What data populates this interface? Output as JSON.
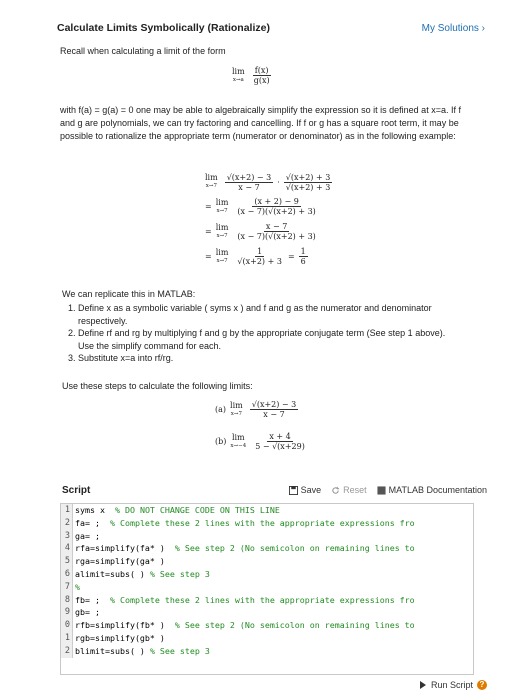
{
  "header": {
    "title": "Calculate Limits Symbolically (Rationalize)",
    "my_solutions": "My Solutions ›"
  },
  "intro": {
    "line1": "Recall when calculating a limit of the form"
  },
  "limit_form": {
    "lim": "lim",
    "sub": "x→a",
    "num": "f(x)",
    "den": "g(x)"
  },
  "para1": "with f(a) = g(a) = 0 one may be able to algebraically simplify the expression so it is defined at x=a. If f and g are polynomials, we can try factoring and cancelling. If f or g has a square root term, it may be possible to rationalize the appropriate term (numerator or denominator) as in the following example:",
  "example": {
    "row1": {
      "lim": "lim",
      "sub": "x→7",
      "num1": "√(x+2) − 3",
      "den1": "x − 7",
      "dot": "·",
      "num2": "√(x+2) + 3",
      "den2": "√(x+2) + 3"
    },
    "row2": {
      "eq": "=",
      "lim": "lim",
      "sub": "x→7",
      "num": "(x + 2) − 9",
      "den": "(x − 7)(√(x+2) + 3)"
    },
    "row3": {
      "eq": "=",
      "lim": "lim",
      "sub": "x→7",
      "num": "x − 7",
      "den": "(x − 7)(√(x+2) + 3)"
    },
    "row4": {
      "eq": "=",
      "lim": "lim",
      "sub": "x→7",
      "num": "1",
      "den": "√(x+2) + 3",
      "eq2": "=",
      "num2": "1",
      "den2": "6"
    }
  },
  "replicate": {
    "intro": "We can replicate this in MATLAB:",
    "steps": [
      "Define x as a symbolic variable ( syms x ) and f and g as the numerator and denominator respectively.",
      "Define rf and rg by multiplying f and g by the appropriate conjugate term (See step 1 above). Use the simplify command for each.",
      "Substitute x=a into rf/rg."
    ],
    "use_steps": "Use these steps to calculate the following limits:"
  },
  "limits": {
    "a": {
      "label": "(a)",
      "lim": "lim",
      "sub": "x→7",
      "num": "√(x+2) − 3",
      "den": "x − 7"
    },
    "b": {
      "label": "(b)",
      "lim": "lim",
      "sub": "x→−4",
      "num": "x + 4",
      "den": "5 − √(x+29)"
    }
  },
  "script": {
    "label": "Script",
    "save": "Save",
    "reset": "Reset",
    "doc": "MATLAB Documentation",
    "lines": [
      {
        "n": "1",
        "code": "syms x  ",
        "comment": "% DO NOT CHANGE CODE ON THIS LINE"
      },
      {
        "n": "2",
        "code": "fa= ;  ",
        "comment": "% Complete these 2 lines with the appropriate expressions fro"
      },
      {
        "n": "3",
        "code": "ga= ;",
        "comment": ""
      },
      {
        "n": "4",
        "code": "rfa=simplify(fa* )  ",
        "comment": "% See step 2 (No semicolon on remaining lines to"
      },
      {
        "n": "5",
        "code": "rga=simplify(ga* )",
        "comment": ""
      },
      {
        "n": "6",
        "code": "alimit=subs( ) ",
        "comment": "% See step 3"
      },
      {
        "n": "7",
        "code": "",
        "comment": "%"
      },
      {
        "n": "8",
        "code": "fb= ;  ",
        "comment": "% Complete these 2 lines with the appropriate expressions fro"
      },
      {
        "n": "9",
        "code": "gb= ;",
        "comment": ""
      },
      {
        "n": "0",
        "code": "rfb=simplify(fb* )  ",
        "comment": "% See step 2 (No semicolon on remaining lines to"
      },
      {
        "n": "1",
        "code": "rgb=simplify(gb* )",
        "comment": ""
      },
      {
        "n": "2",
        "code": "blimit=subs( ) ",
        "comment": "% See step 3"
      }
    ]
  },
  "run": {
    "label": "Run Script"
  }
}
